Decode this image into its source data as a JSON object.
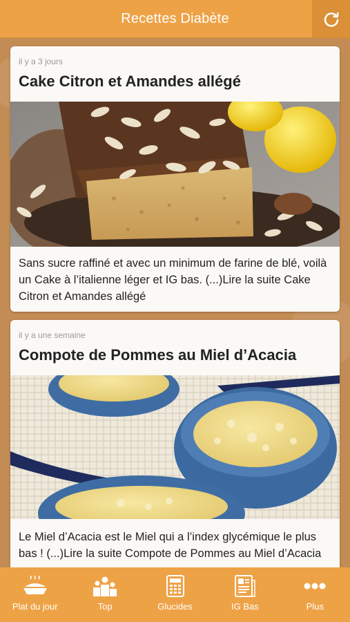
{
  "header": {
    "title": "Recettes Diabète",
    "refresh_icon": "refresh-icon"
  },
  "colors": {
    "accent": "#eea246",
    "accent_dark": "#db8f36",
    "background": "#c38c55",
    "card": "#fbf9f6"
  },
  "feed": {
    "posts": [
      {
        "date": "il y a 3 jours",
        "title": "Cake Citron et Amandes allégé",
        "image": "lemon-almond-cake-photo",
        "excerpt": "Sans sucre raffiné et avec un minimum de farine de blé, voilà un Cake à l’italienne léger et IG bas. (...)Lire la suite Cake Citron et Amandes allégé"
      },
      {
        "date": "il y a une semaine",
        "title": "Compote de Pommes au Miel d’Acacia",
        "image": "apple-compote-bowls-photo",
        "excerpt": "Le Miel d’Acacia est le Miel qui a l’index glycémique le plus bas ! (...)Lire la suite Compote de Pommes au Miel d’Acacia"
      }
    ]
  },
  "tabbar": {
    "items": [
      {
        "label": "Plat du jour",
        "icon": "dish-icon"
      },
      {
        "label": "Top",
        "icon": "podium-icon"
      },
      {
        "label": "Glucides",
        "icon": "calculator-icon"
      },
      {
        "label": "IG Bas",
        "icon": "document-icon"
      },
      {
        "label": "Plus",
        "icon": "more-icon"
      }
    ]
  }
}
